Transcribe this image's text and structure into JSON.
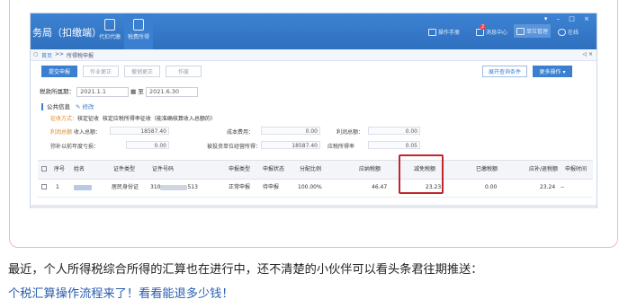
{
  "app": {
    "title": "务局（扣缴端）",
    "nav": [
      {
        "label": "代扣代缴",
        "icon": "doc-icon"
      },
      {
        "label": "税费所得",
        "icon": "stack-icon"
      }
    ],
    "tools": [
      {
        "label": "操作手册",
        "icon": "book-icon"
      },
      {
        "label": "消息中心",
        "icon": "bell-icon",
        "badge": "2"
      },
      {
        "label": "单位管理",
        "icon": "building-icon"
      },
      {
        "label": "在线",
        "icon": "chat-icon"
      }
    ],
    "window_controls": "▾ – □ ×"
  },
  "breadcrumb": {
    "home": "首页",
    "sep": ">>",
    "current": "所得税申报",
    "close_controls": "◁ ×"
  },
  "buttons": {
    "submit": "提交申报",
    "btn2": "作业更正",
    "btn3": "撤销更正",
    "btn4": "作废",
    "view_records": "展开查询条件",
    "more": "更多操作 ▾"
  },
  "period": {
    "label": "税款所属期：",
    "start": "2021.1.1",
    "to": "至",
    "end": "2021.6.30"
  },
  "info": {
    "title": "公共信息",
    "edit": "修改",
    "collect_label": "征收方式：",
    "collect_value": "核定征收",
    "collect_detail": "核定应税所得率征收（能准确核算收入总额的）",
    "profit_label": "利润总额",
    "income_label": "收入总额：",
    "income_value": "18587.40",
    "cost_label": "成本费用：",
    "cost_value": "0.00",
    "profit2_label": "利润总额：",
    "profit2_value": "0.00",
    "loss_label": "弥补以前年度亏损：",
    "loss_value": "0.00",
    "adj_label": "被投资单位经营所得：",
    "adj_value": "18587.40",
    "rate_label": "应税所得率",
    "rate_value": "0.05"
  },
  "table": {
    "headers": [
      "序号",
      "姓名",
      "证件类型",
      "证件号码",
      "申报类型",
      "申报状态",
      "分配比例",
      "应纳税额",
      "减免税额",
      "已缴税额",
      "应补/退税额",
      "申报时间"
    ],
    "rows": [
      {
        "index": "1",
        "id_type": "居民身份证",
        "id_no_prefix": "310",
        "id_no_suffix": "513",
        "decl_type": "正常申报",
        "status": "待申报",
        "ratio": "100.00%",
        "tax_payable": "46.47",
        "reduction": "23.23",
        "paid": "0.00",
        "refund": "23.24",
        "time": "--"
      }
    ]
  },
  "caption": {
    "text": "最近，个人所得税综合所得的汇算也在进行中，还不清楚的小伙伴可以看头条君往期推送：",
    "link": "个税汇算操作流程来了！看看能退多少钱！"
  },
  "colors": {
    "accent": "#3b7fd0",
    "highlight_border": "#c0262c",
    "link": "#2a5db0"
  }
}
